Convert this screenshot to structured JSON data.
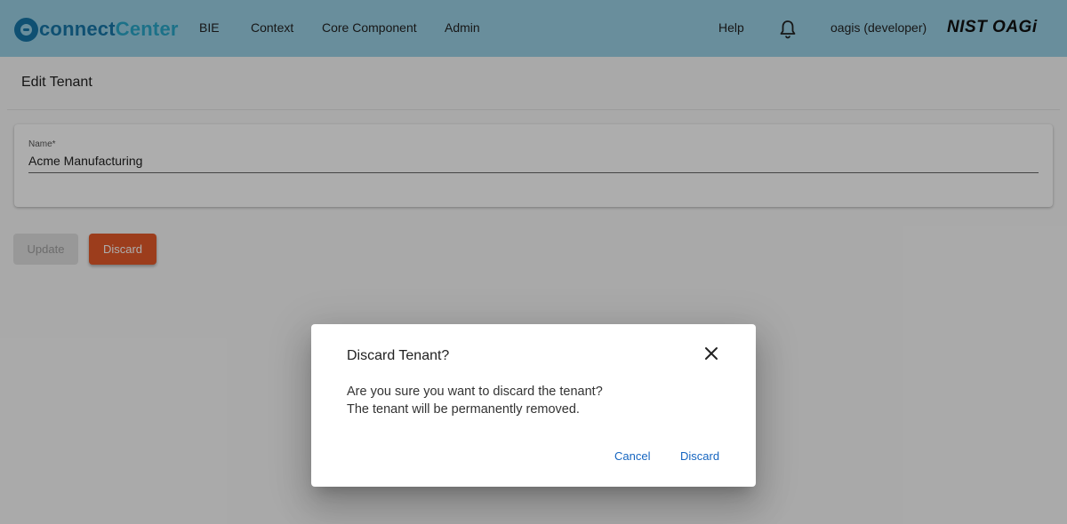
{
  "app": {
    "logo_text_1": "connect",
    "logo_text_2": "Center",
    "brand_right": "NIST OAGi"
  },
  "nav": {
    "items": [
      {
        "label": "BIE"
      },
      {
        "label": "Context"
      },
      {
        "label": "Core Component"
      },
      {
        "label": "Admin"
      }
    ],
    "help": "Help",
    "user": "oagis (developer)"
  },
  "page": {
    "title": "Edit Tenant",
    "name_field": {
      "label": "Name*",
      "value": "Acme Manufacturing"
    },
    "update_label": "Update",
    "discard_label": "Discard"
  },
  "dialog": {
    "title": "Discard Tenant?",
    "message_line1": "Are you sure you want to discard the tenant?",
    "message_line2": "The tenant will be permanently removed.",
    "cancel_label": "Cancel",
    "confirm_label": "Discard"
  },
  "icons": {
    "bell": "bell-icon",
    "close": "close-icon"
  },
  "colors": {
    "topbar": "#9bd2e6",
    "brand_primary": "#1776a8",
    "brand_secondary": "#2aa7c9",
    "discard_button": "#e65a2a",
    "dialog_link": "#1565c0"
  }
}
